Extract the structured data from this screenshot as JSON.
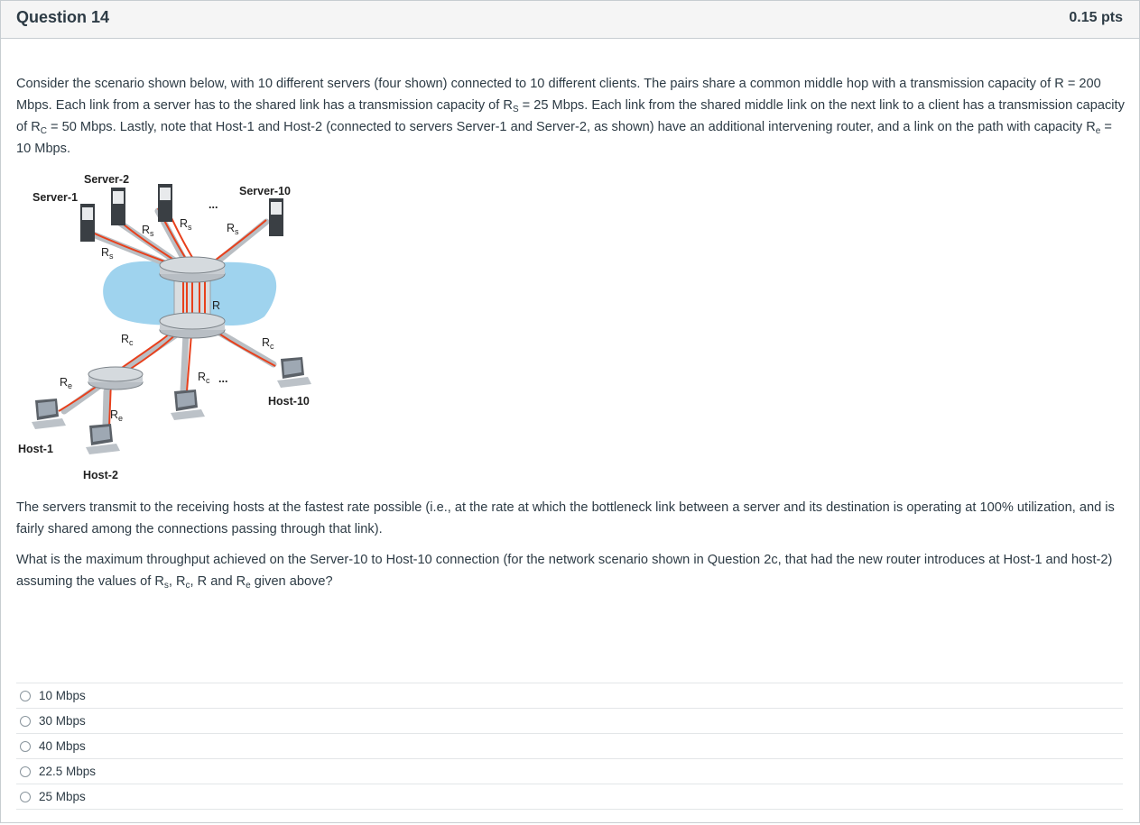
{
  "header": {
    "title": "Question 14",
    "points": "0.15 pts"
  },
  "body": {
    "intro": [
      {
        "t": "Consider the scenario shown below, with 10 different servers (four shown) connected to 10 different clients. The pairs share a common middle hop with a transmission capacity of R = 200 Mbps. Each link from a server has to the shared link has a transmission capacity of R"
      },
      {
        "s": "S"
      },
      {
        "t": " = 25 Mbps. Each link from the shared middle link on the next link to a client has a transmission capacity of R"
      },
      {
        "s": "C"
      },
      {
        "t": " = 50 Mbps.  Lastly, note that Host-1 and Host-2 (connected to servers Server-1 and Server-2, as shown)  have an additional intervening router, and a  link on the path with capacity R"
      },
      {
        "s": "e"
      },
      {
        "t": " = 10 Mbps."
      }
    ],
    "transmit": "The servers  transmit to the receiving hosts at the fastest rate possible (i.e., at the rate at which the bottleneck link between a server and its destination is operating at 100% utilization, and is fairly shared among the connections passing through that link).",
    "question": [
      {
        "t": "What is the maximum throughput achieved on the Server-10 to Host-10 connection (for the network scenario shown in Question 2c, that had the new router introduces at Host-1 and host-2) assuming the values of R"
      },
      {
        "s": "s"
      },
      {
        "t": ", R"
      },
      {
        "s": "c"
      },
      {
        "t": ", R and R"
      },
      {
        "s": "e"
      },
      {
        "t": " given above?"
      }
    ]
  },
  "figure": {
    "labels": {
      "server1": "Server-1",
      "server2": "Server-2",
      "server10": "Server-10",
      "host1": "Host-1",
      "host2": "Host-2",
      "host10": "Host-10",
      "dots_top": "...",
      "dots_mid": "..."
    },
    "rate_labels": [
      {
        "base": "R",
        "sub": "s"
      },
      {
        "base": "R",
        "sub": "s"
      },
      {
        "base": "R",
        "sub": "s"
      },
      {
        "base": "R",
        "sub": "s"
      },
      {
        "base": "R",
        "sub": ""
      },
      {
        "base": "R",
        "sub": "c"
      },
      {
        "base": "R",
        "sub": "c"
      },
      {
        "base": "R",
        "sub": "c"
      },
      {
        "base": "R",
        "sub": "e"
      },
      {
        "base": "R",
        "sub": "e"
      }
    ],
    "colors": {
      "cloud": "#9fd3ee",
      "path": "#e8401c",
      "router": "#c8cdd2"
    }
  },
  "answers": [
    {
      "label": "10 Mbps"
    },
    {
      "label": "30 Mbps"
    },
    {
      "label": "40 Mbps"
    },
    {
      "label": "22.5 Mbps"
    },
    {
      "label": "25 Mbps"
    }
  ]
}
